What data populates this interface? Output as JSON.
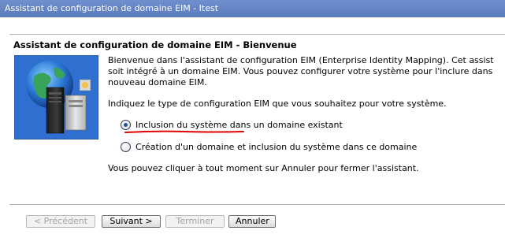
{
  "window": {
    "title": "Assistant de configuration de domaine EIM - Itest"
  },
  "wizard": {
    "heading": "Assistant de configuration de domaine EIM - Bienvenue",
    "intro_lines": [
      "Bienvenue dans l'assistant de configuration EIM (Enterprise Identity Mapping). Cet assist",
      "soit intégré à un domaine EIM. Vous pouvez configurer votre système pour l'inclure dans",
      "nouveau domaine EIM."
    ],
    "prompt": "Indiquez le type de configuration EIM que vous souhaitez pour votre système.",
    "options": [
      {
        "label": "Inclusion du système dans un domaine existant",
        "selected": true
      },
      {
        "label": "Création d'un domaine et inclusion du système dans ce domaine",
        "selected": false
      }
    ],
    "cancel_hint": "Vous pouvez cliquer à tout moment sur Annuler pour fermer l'assistant."
  },
  "buttons": {
    "previous": "< Précédent",
    "next": "Suivant >",
    "finish": "Terminer",
    "cancel": "Annuler"
  },
  "icons": {
    "wizard_image": "eim-globe-server-icon",
    "radio_selected": "radio-selected-icon",
    "radio_unselected": "radio-unselected-icon"
  },
  "colors": {
    "title_bar": "#6f8fcd",
    "title_text": "#ffffff",
    "underline_mark": "#e00000"
  }
}
